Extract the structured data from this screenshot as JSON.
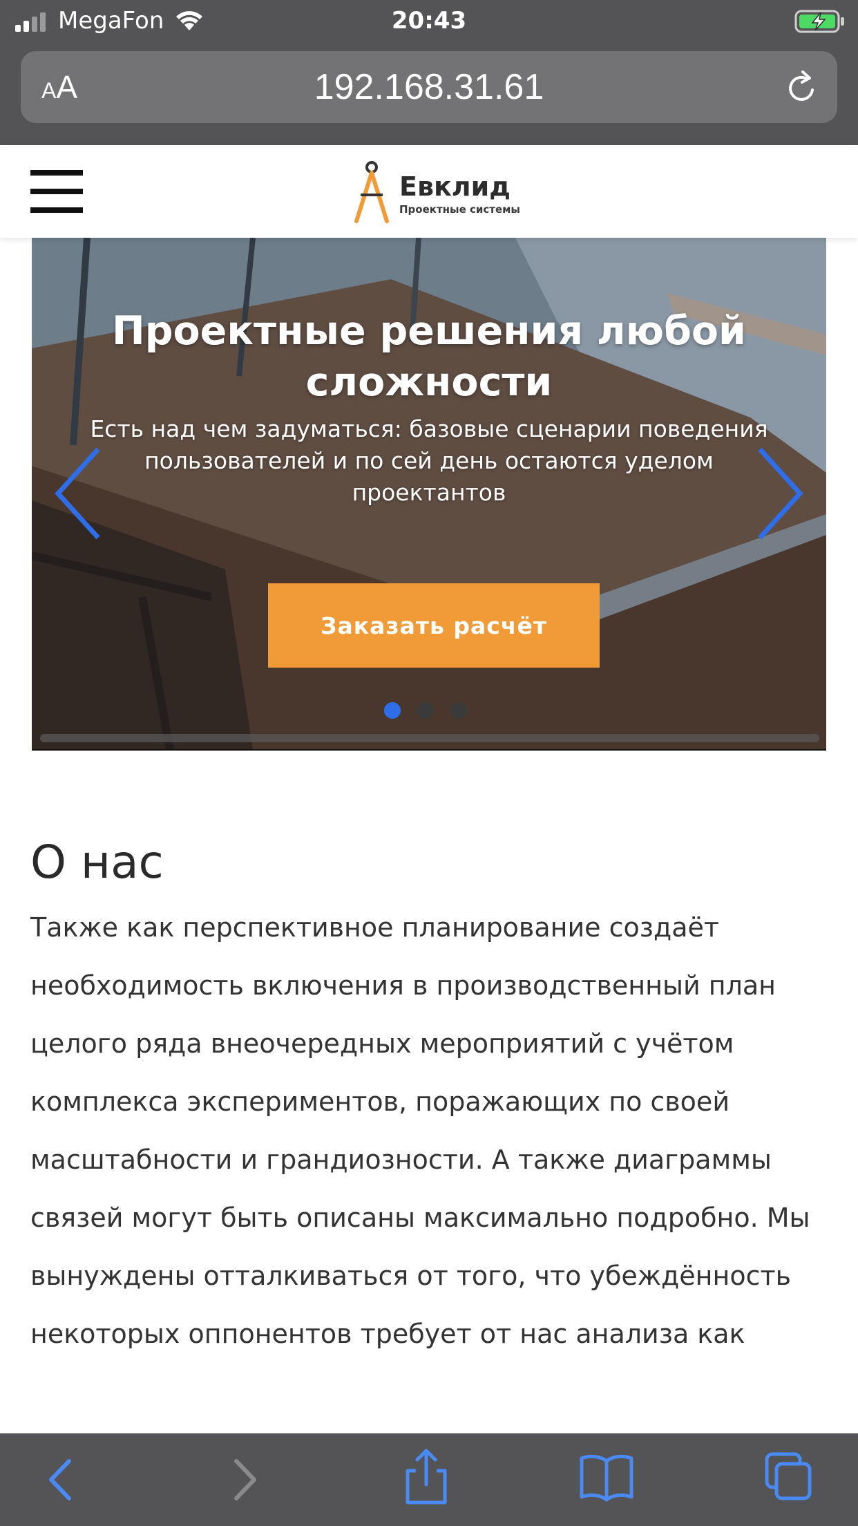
{
  "status_bar": {
    "carrier": "MegaFon",
    "time": "20:43"
  },
  "browser": {
    "aa_small": "A",
    "aa_big": "A",
    "url": "192.168.31.61"
  },
  "site": {
    "logo_title": "Евклид",
    "logo_subtitle": "Проектные системы"
  },
  "hero": {
    "title": "Проектные решения любой сложности",
    "text": "Есть над чем задуматься: базовые сценарии поведения пользователей и по сей день остаются уделом проектантов",
    "cta_label": "Заказать расчёт",
    "slide_count": 3,
    "active_slide": 1
  },
  "about": {
    "heading": "О нас",
    "text": "Также как перспективное планирование создаёт необходимость включения в производственный план целого ряда внеочередных мероприятий с учётом комплекса экспериментов, поражающих по своей масштабности и грандиозности. А также диаграммы связей могут быть описаны максимально подробно. Мы вынуждены отталкиваться от того, что убеждённость некоторых оппонентов требует от нас анализа как"
  },
  "colors": {
    "accent_orange": "#f09b38",
    "arrow_blue": "#2e6ee8",
    "toolbar_blue": "#4a8af4",
    "chrome_gray": "#545456"
  }
}
